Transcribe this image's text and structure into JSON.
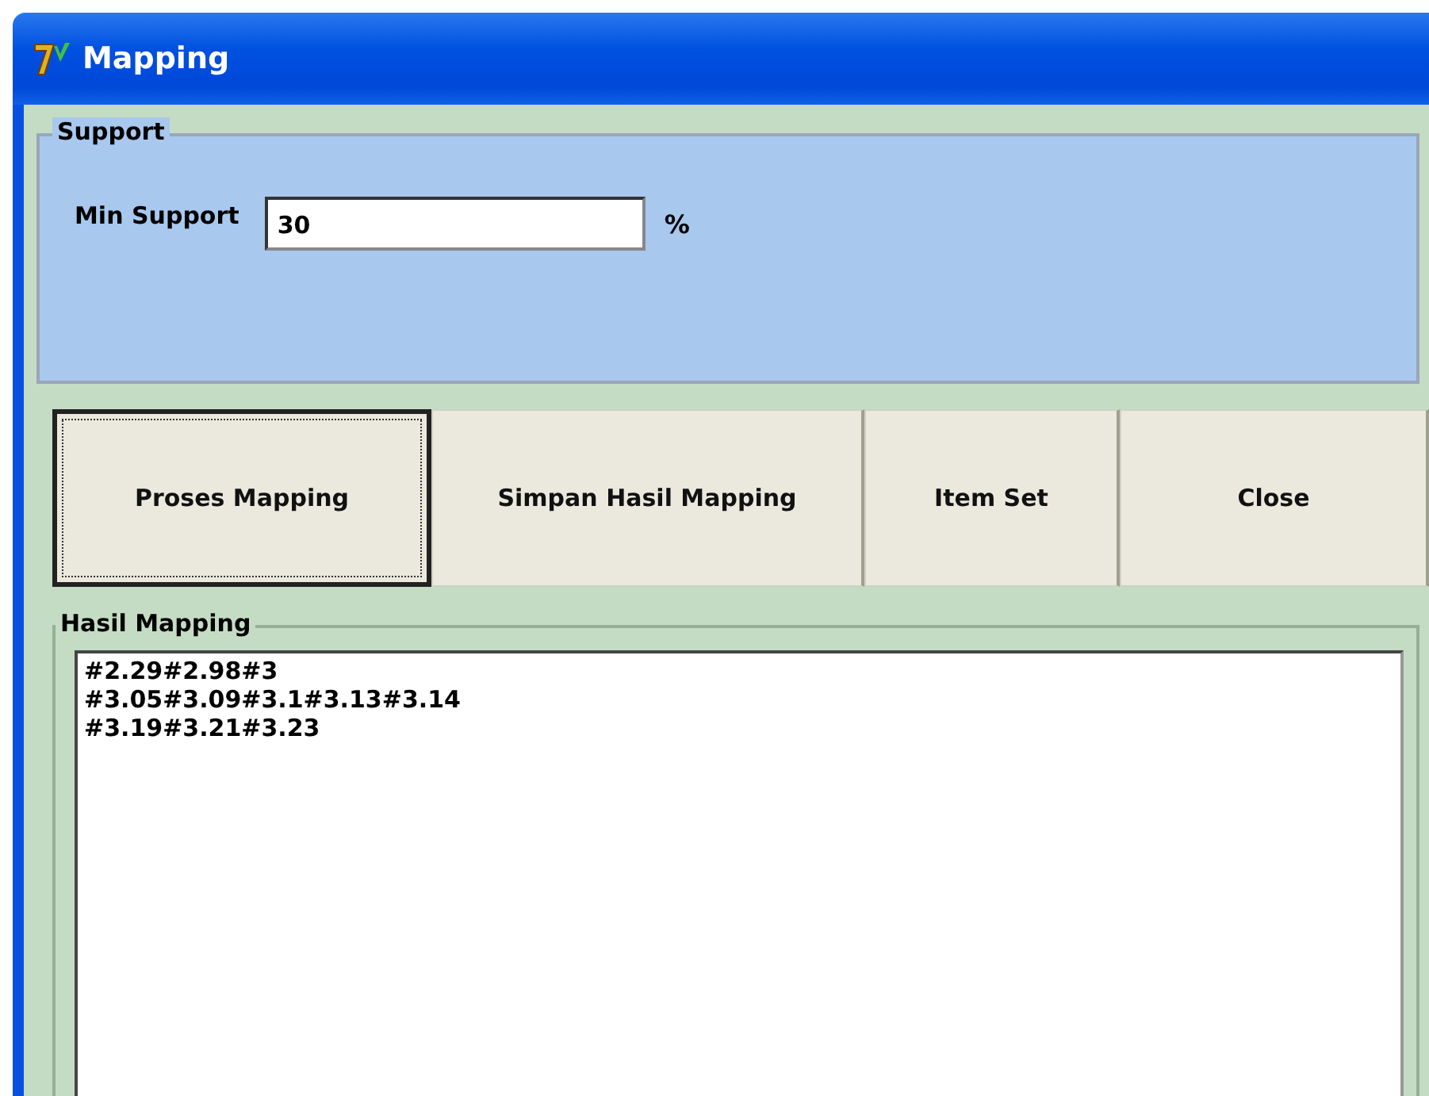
{
  "window": {
    "title": "Mapping"
  },
  "support": {
    "title": "Support",
    "label": "Min Support",
    "value": "30",
    "unit": "%"
  },
  "buttons": [
    {
      "label": "Proses Mapping",
      "focused": true
    },
    {
      "label": "Simpan Hasil Mapping",
      "focused": false
    },
    {
      "label": "Item Set",
      "focused": false
    },
    {
      "label": "Close",
      "focused": false
    }
  ],
  "result": {
    "title": "Hasil Mapping",
    "lines": [
      "#2.29#2.98#3",
      "#3.05#3.09#3.1#3.13#3.14",
      "#3.19#3.21#3.23"
    ]
  }
}
